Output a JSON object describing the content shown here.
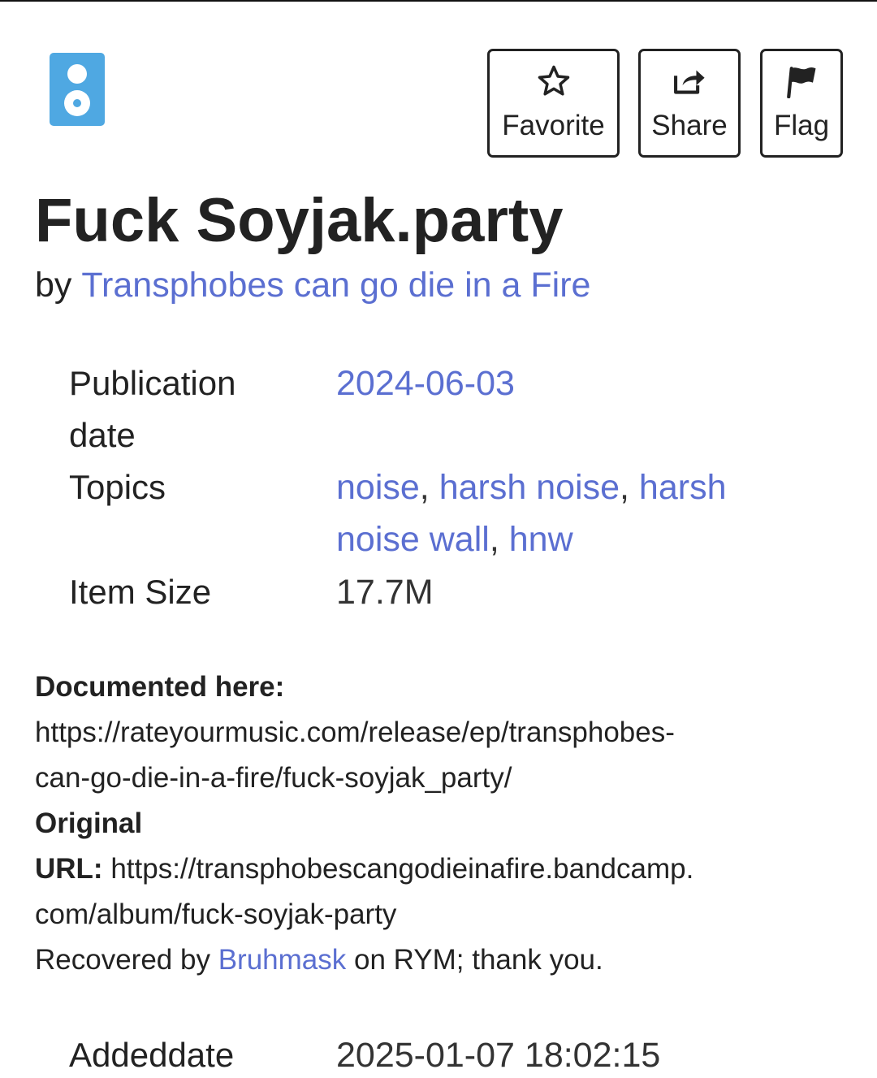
{
  "item": {
    "title": "Fuck Soyjak.party",
    "by_prefix": "by",
    "creator": "Transphobes can go die in a Fire"
  },
  "actions": {
    "favorite_label": "Favorite",
    "share_label": "Share",
    "flag_label": "Flag"
  },
  "metadata": {
    "publication_date_label_line1": "Publication",
    "publication_date_label_line2": "date",
    "publication_date_value": "2024-06-03",
    "topics_label": "Topics",
    "topics": [
      "noise",
      "harsh noise",
      "harsh noise wall",
      "hnw"
    ],
    "topics_separator": ", ",
    "item_size_label": "Item Size",
    "item_size_value": "17.7M",
    "addeddate_label": "Addeddate",
    "addeddate_value": "2025-01-07 18:02:15"
  },
  "description": {
    "documented_label": "Documented here:",
    "documented_url_line1": "https://rateyourmusic.com/release/ep/transphobes-",
    "documented_url_line2": "can-go-die-in-a-fire/fuck-soyjak_party/",
    "original_label_line1": "Original",
    "original_label_line2": "URL:",
    "original_url_line1": "https://transphobescangodieinafire.bandcamp.",
    "original_url_line2": "com/album/fuck-soyjak-party",
    "recovered_prefix": "Recovered by",
    "recovered_user": "Bruhmask",
    "recovered_suffix": "on RYM; thank you."
  },
  "icons": {
    "mediatype": "audio-speaker-icon",
    "favorite": "star-icon",
    "share": "share-icon",
    "flag": "flag-icon"
  },
  "colors": {
    "link": "#5b6fd1",
    "mediatype_icon": "#4fa8e2",
    "text": "#222222"
  }
}
